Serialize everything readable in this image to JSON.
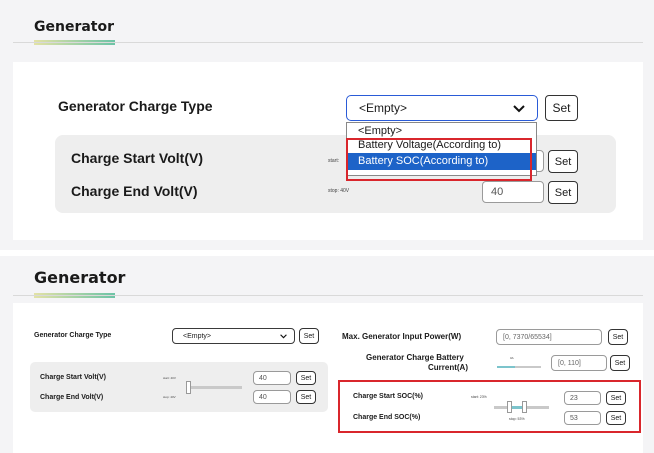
{
  "top": {
    "title": "Generator",
    "charge_type_label": "Generator Charge Type",
    "charge_type_value": "<Empty>",
    "set_label": "Set",
    "dropdown_options": [
      "<Empty>",
      "Battery Voltage(According to)",
      "Battery SOC(According to)"
    ],
    "dropdown_selected": "Battery SOC(According to)",
    "start_volt_label": "Charge Start Volt(V)",
    "end_volt_label": "Charge End Volt(V)",
    "start_slider_text": "start:",
    "stop_slider_text": "stop: 40V",
    "start_volt_value": "",
    "end_volt_value": "40"
  },
  "bottom": {
    "title": "Generator",
    "charge_type_label": "Generator Charge Type",
    "charge_type_value": "<Empty>",
    "set_label": "Set",
    "start_volt_label": "Charge Start Volt(V)",
    "end_volt_label": "Charge End Volt(V)",
    "start_volt_slider_text": "start: 40V",
    "stop_volt_slider_text": "stop: 40V",
    "start_volt_value": "40",
    "end_volt_value": "40",
    "max_input_power_label": "Max. Generator Input Power(W)",
    "max_input_power_placeholder": "[0, 7370/65534]",
    "battery_current_label_line1": "Generator Charge Battery",
    "battery_current_label_line2": "Current(A)",
    "battery_current_slider_text": "0A",
    "battery_current_placeholder": "[0, 110]",
    "start_soc_label": "Charge Start SOC(%)",
    "end_soc_label": "Charge End SOC(%)",
    "start_soc_slider_text": "start: 23%",
    "stop_soc_slider_text": "stop: 53%",
    "start_soc_value": "23",
    "end_soc_value": "53"
  },
  "colors": {
    "highlight": "#d9262c",
    "dropdown_selected_bg": "#1d63c8",
    "dropdown_focus_border": "#2a5bd7",
    "accent_start": "#e3e2a6",
    "accent_end": "#6cc3a6",
    "slider_fill": "#7cc4cc"
  }
}
